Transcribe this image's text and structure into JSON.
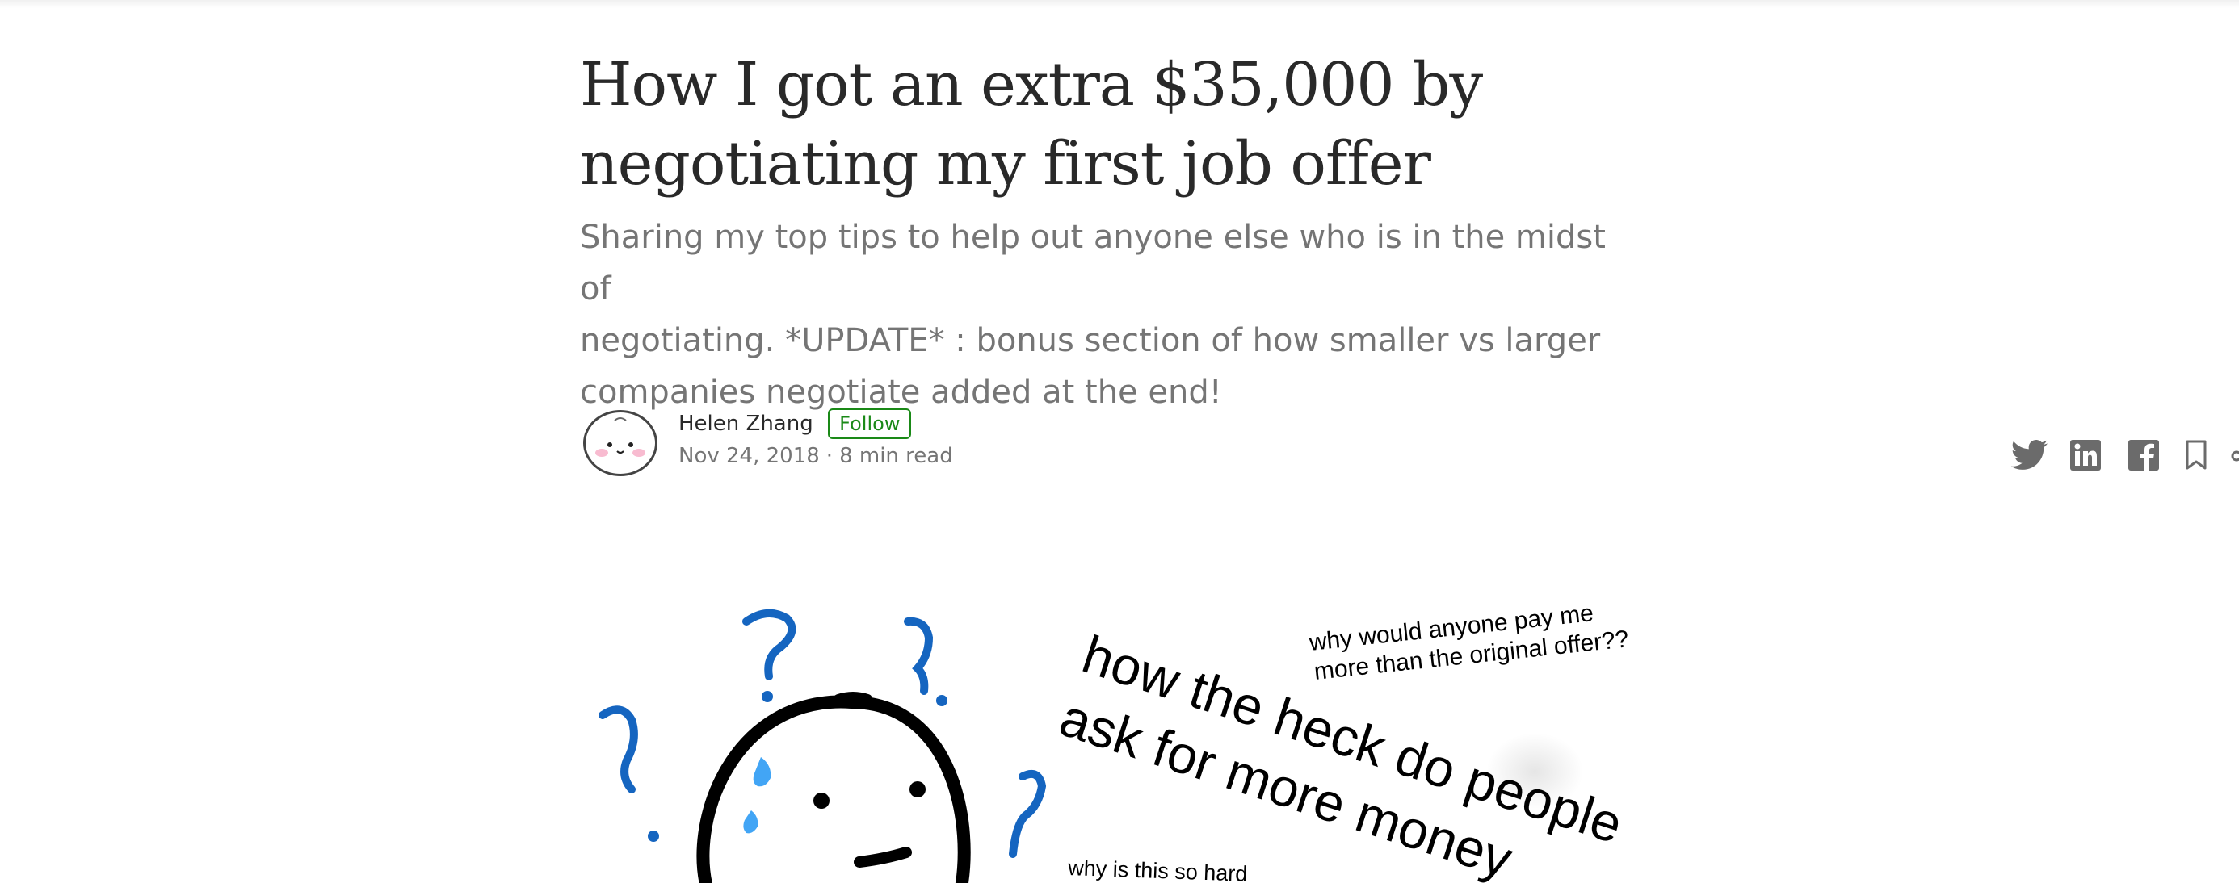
{
  "article": {
    "title_line1": "How I got an extra $35,000 by",
    "title_line2": "negotiating my first job offer",
    "subtitle_line1": "Sharing my top tips to help out anyone else who is in the midst of",
    "subtitle_line2": "negotiating. *UPDATE* : bonus section of how smaller vs larger",
    "subtitle_line3": "companies negotiate added at the end!"
  },
  "author": {
    "name": "Helen Zhang",
    "follow_label": "Follow",
    "date": "Nov 24, 2018",
    "separator": "·",
    "read_time": "8 min read"
  },
  "share_actions": [
    "twitter-icon",
    "linkedin-icon",
    "facebook-icon",
    "bookmark-icon",
    "more-icon"
  ],
  "hero_image": {
    "texts": {
      "main_line1": "how the heck do people",
      "main_line2": "ask for more money",
      "question_line1": "why would anyone pay me",
      "question_line2": "more than the original offer??",
      "small": "why is this so hard"
    },
    "colors": {
      "question_marks": "#1565c0",
      "sweat": "#42a5f5",
      "ink": "#000000"
    }
  },
  "colors": {
    "follow_green": "#1a8917",
    "icon_gray": "#6b6b6b"
  }
}
